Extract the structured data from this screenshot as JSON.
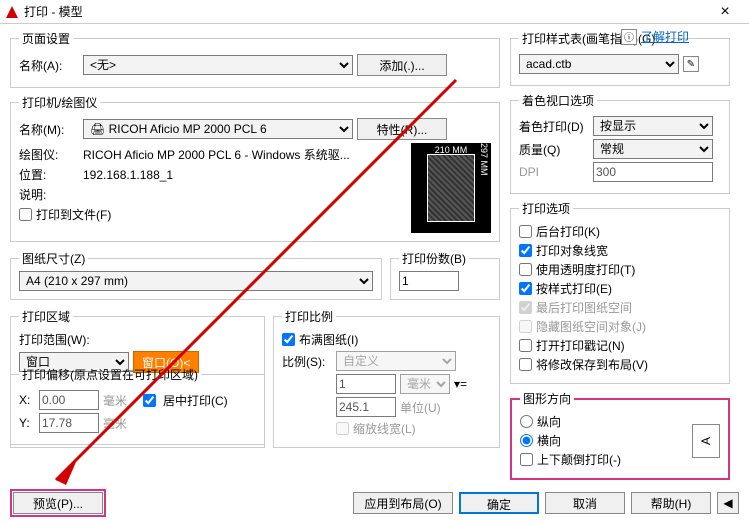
{
  "titlebar": {
    "title": "打印 - 模型",
    "close": "×"
  },
  "learn_link": "了解打印",
  "page_setup": {
    "legend": "页面设置",
    "name_label": "名称(A):",
    "name_value": "<无>",
    "add_btn": "添加(.)..."
  },
  "printer": {
    "legend": "打印机/绘图仪",
    "name_label": "名称(M):",
    "name_value": "🖨 RICOH Aficio MP 2000 PCL 6",
    "props_btn": "特性(R)...",
    "plotter_label": "绘图仪:",
    "plotter_value": "RICOH Aficio MP 2000 PCL 6 - Windows 系统驱...",
    "loc_label": "位置:",
    "loc_value": "192.168.1.188_1",
    "desc_label": "说明:",
    "plot_to_file": "打印到文件(F)",
    "paper_w": "210 MM",
    "paper_h": "297 MM"
  },
  "paper": {
    "legend": "图纸尺寸(Z)",
    "value": "A4 (210 x 297 mm)"
  },
  "copies": {
    "legend": "打印份数(B)",
    "value": "1"
  },
  "area": {
    "legend": "打印区域",
    "what_label": "打印范围(W):",
    "what_value": "窗口",
    "window_btn": "窗口(O)<"
  },
  "scale": {
    "legend": "打印比例",
    "fit": "布满图纸(I)",
    "ratio_label": "比例(S):",
    "ratio_value": "自定义",
    "unit1": "1",
    "unit1_label": "毫米",
    "unit2": "245.1",
    "unit2_label": "单位(U)",
    "scale_lw": "缩放线宽(L)"
  },
  "offset": {
    "legend": "打印偏移(原点设置在可打印区域)",
    "x_label": "X:",
    "x_value": "0.00",
    "y_label": "Y:",
    "y_value": "17.78",
    "mm": "毫米",
    "center": "居中打印(C)"
  },
  "style": {
    "legend": "打印样式表(画笔指定)(G)",
    "value": "acad.ctb"
  },
  "viewport": {
    "legend": "着色视口选项",
    "shade_label": "着色打印(D)",
    "shade_value": "按显示",
    "quality_label": "质量(Q)",
    "quality_value": "常规",
    "dpi_label": "DPI",
    "dpi_value": "300"
  },
  "options": {
    "legend": "打印选项",
    "o1": "后台打印(K)",
    "o2": "打印对象线宽",
    "o3": "使用透明度打印(T)",
    "o4": "按样式打印(E)",
    "o5": "最后打印图纸空间",
    "o6": "隐藏图纸空间对象(J)",
    "o7": "打开打印戳记(N)",
    "o8": "将修改保存到布局(V)"
  },
  "orient": {
    "legend": "图形方向",
    "portrait": "纵向",
    "landscape": "横向",
    "upside": "上下颠倒打印(-)",
    "icon": "A"
  },
  "buttons": {
    "preview": "预览(P)...",
    "apply": "应用到布局(O)",
    "ok": "确定",
    "cancel": "取消",
    "help": "帮助(H)"
  }
}
